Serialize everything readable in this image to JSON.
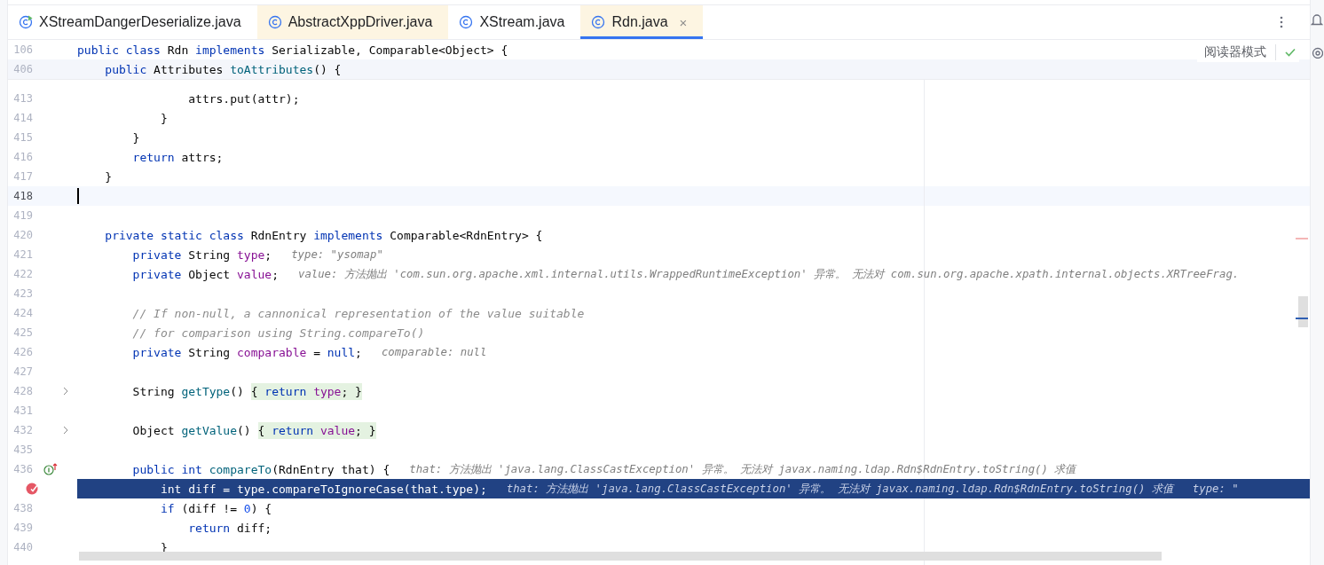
{
  "tabs": [
    {
      "label": "XStreamDangerDeserialize.java",
      "kind": "runnable",
      "color": "#ffffff",
      "selected": false
    },
    {
      "label": "AbstractXppDriver.java",
      "kind": "class",
      "color": "#fdf5e2",
      "selected": false
    },
    {
      "label": "XStream.java",
      "kind": "class",
      "color": "#ffffff",
      "selected": false
    },
    {
      "label": "Rdn.java",
      "kind": "class",
      "color": "#fdf5e2",
      "selected": true,
      "close": "×"
    }
  ],
  "reader_mode": {
    "label": "阅读器模式"
  },
  "sticky_lines": [
    {
      "number": "106",
      "tokens": [
        {
          "kind": "kw",
          "text": "public class"
        },
        {
          "kind": "plain",
          "text": " Rdn "
        },
        {
          "kind": "kw",
          "text": "implements"
        },
        {
          "kind": "plain",
          "text": " Serializable, Comparable<Object> {"
        }
      ]
    },
    {
      "number": "406",
      "tokens": [
        {
          "kind": "kw",
          "text": "    public"
        },
        {
          "kind": "plain",
          "text": " Attributes "
        },
        {
          "kind": "fn",
          "text": "toAttributes"
        },
        {
          "kind": "plain",
          "text": "() {"
        }
      ]
    }
  ],
  "lines": [
    {
      "number": "413",
      "tokens": [
        {
          "kind": "plain",
          "text": "                attrs.put(attr);"
        }
      ]
    },
    {
      "number": "414",
      "tokens": [
        {
          "kind": "plain",
          "text": "            }"
        }
      ]
    },
    {
      "number": "415",
      "tokens": [
        {
          "kind": "plain",
          "text": "        }"
        }
      ]
    },
    {
      "number": "416",
      "tokens": [
        {
          "kind": "kw",
          "text": "        return"
        },
        {
          "kind": "plain",
          "text": " attrs;"
        }
      ]
    },
    {
      "number": "417",
      "tokens": [
        {
          "kind": "plain",
          "text": "    }"
        }
      ]
    },
    {
      "number": "418",
      "current": true
    },
    {
      "number": "419"
    },
    {
      "number": "420",
      "tokens": [
        {
          "kind": "kw",
          "text": "    private static class"
        },
        {
          "kind": "plain",
          "text": " RdnEntry "
        },
        {
          "kind": "kw",
          "text": "implements"
        },
        {
          "kind": "plain",
          "text": " Comparable<RdnEntry> {"
        }
      ]
    },
    {
      "number": "421",
      "tokens": [
        {
          "kind": "kw",
          "text": "        private"
        },
        {
          "kind": "plain",
          "text": " String "
        },
        {
          "kind": "field",
          "text": "type"
        },
        {
          "kind": "plain",
          "text": ";"
        },
        {
          "kind": "hint",
          "text": "type: \"ysomap\""
        }
      ]
    },
    {
      "number": "422",
      "tokens": [
        {
          "kind": "kw",
          "text": "        private"
        },
        {
          "kind": "plain",
          "text": " Object "
        },
        {
          "kind": "field",
          "text": "value"
        },
        {
          "kind": "plain",
          "text": ";"
        },
        {
          "kind": "hint",
          "text": "value: 方法抛出 'com.sun.org.apache.xml.internal.utils.WrappedRuntimeException' 异常。 无法对 com.sun.org.apache.xpath.internal.objects.XRTreeFrag."
        }
      ]
    },
    {
      "number": "423"
    },
    {
      "number": "424",
      "tokens": [
        {
          "kind": "comment",
          "text": "        // If non-null, a cannonical representation of the value suitable"
        }
      ]
    },
    {
      "number": "425",
      "tokens": [
        {
          "kind": "comment",
          "text": "        // for comparison using String.compareTo()"
        }
      ]
    },
    {
      "number": "426",
      "tokens": [
        {
          "kind": "kw",
          "text": "        private"
        },
        {
          "kind": "plain",
          "text": " String "
        },
        {
          "kind": "field",
          "text": "comparable"
        },
        {
          "kind": "plain",
          "text": " = "
        },
        {
          "kind": "kw",
          "text": "null"
        },
        {
          "kind": "plain",
          "text": ";"
        },
        {
          "kind": "hint",
          "text": "comparable: null"
        }
      ]
    },
    {
      "number": "427"
    },
    {
      "number": "428",
      "fold": true,
      "tokens": [
        {
          "kind": "plain",
          "text": "        String "
        },
        {
          "kind": "fn",
          "text": "getType"
        },
        {
          "kind": "plain",
          "text": "() "
        },
        {
          "kind": "fold",
          "children": [
            {
              "kind": "plain",
              "text": "{ "
            },
            {
              "kind": "kw",
              "text": "return"
            },
            {
              "kind": "field",
              "text": " type"
            },
            {
              "kind": "plain",
              "text": "; }"
            }
          ]
        }
      ]
    },
    {
      "number": "431"
    },
    {
      "number": "432",
      "fold": true,
      "tokens": [
        {
          "kind": "plain",
          "text": "        Object "
        },
        {
          "kind": "fn",
          "text": "getValue"
        },
        {
          "kind": "plain",
          "text": "() "
        },
        {
          "kind": "fold",
          "children": [
            {
              "kind": "plain",
              "text": "{ "
            },
            {
              "kind": "kw",
              "text": "return"
            },
            {
              "kind": "field",
              "text": " value"
            },
            {
              "kind": "plain",
              "text": "; }"
            }
          ]
        }
      ]
    },
    {
      "number": "435"
    },
    {
      "number": "436",
      "override": true,
      "tokens": [
        {
          "kind": "kw",
          "text": "        public int"
        },
        {
          "kind": "fn",
          "text": " compareTo"
        },
        {
          "kind": "plain",
          "text": "(RdnEntry that) {"
        },
        {
          "kind": "hint",
          "text": "that: 方法抛出 'java.lang.ClassCastException' 异常。 无法对 javax.naming.ldap.Rdn$RdnEntry.toString() 求值"
        }
      ]
    },
    {
      "execution": true,
      "breakpoint": true,
      "tokens": [
        {
          "kind": "kw",
          "text": "            int"
        },
        {
          "kind": "plain",
          "text": " diff = type.compareToIgnoreCase(that.type);"
        },
        {
          "kind": "hint",
          "text": "that: 方法抛出 'java.lang.ClassCastException' 异常。 无法对 javax.naming.ldap.Rdn$RdnEntry.toString() 求值"
        },
        {
          "kind": "hint",
          "text": "type: \""
        }
      ]
    },
    {
      "number": "438",
      "tokens": [
        {
          "kind": "kw",
          "text": "            if"
        },
        {
          "kind": "plain",
          "text": " (diff != "
        },
        {
          "kind": "num",
          "text": "0"
        },
        {
          "kind": "plain",
          "text": ") {"
        }
      ]
    },
    {
      "number": "439",
      "tokens": [
        {
          "kind": "kw",
          "text": "                return"
        },
        {
          "kind": "plain",
          "text": " diff;"
        }
      ]
    },
    {
      "number": "440",
      "tokens": [
        {
          "kind": "plain",
          "text": "            }"
        }
      ]
    }
  ]
}
